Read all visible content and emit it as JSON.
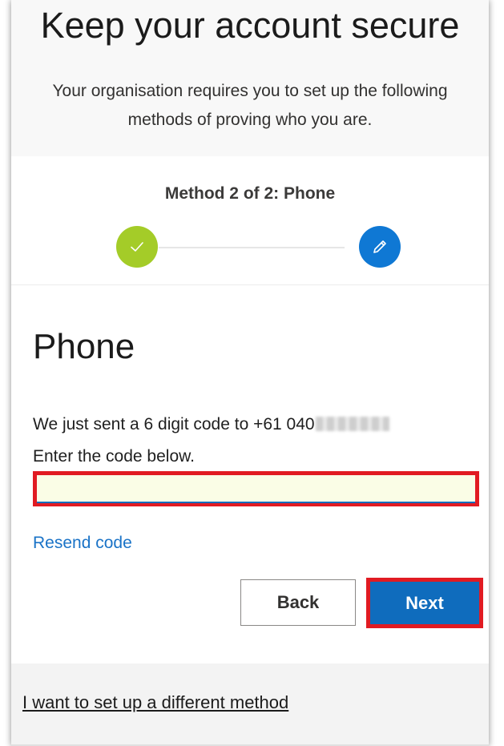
{
  "header": {
    "title": "Keep your account secure",
    "subtitle_line1": "Your organisation requires you to set up the following",
    "subtitle_line2": "methods of proving who you are."
  },
  "stepper": {
    "title": "Method 2 of 2: Phone",
    "steps": [
      {
        "status": "complete",
        "icon": "checkmark-icon",
        "color": "#a4cc28"
      },
      {
        "status": "current",
        "icon": "pencil-icon",
        "color": "#0f78d4"
      }
    ]
  },
  "phone": {
    "heading": "Phone",
    "sent_message": "We just sent a 6 digit code to +61 040",
    "instruction": "Enter the code below.",
    "code_value": "",
    "code_placeholder": "",
    "resend_label": "Resend code"
  },
  "actions": {
    "back_label": "Back",
    "next_label": "Next"
  },
  "footer": {
    "different_method_label": "I want to set up a different method"
  },
  "colors": {
    "accent": "#0f6cbd",
    "highlight": "#e11b22",
    "success": "#a4cc28"
  }
}
